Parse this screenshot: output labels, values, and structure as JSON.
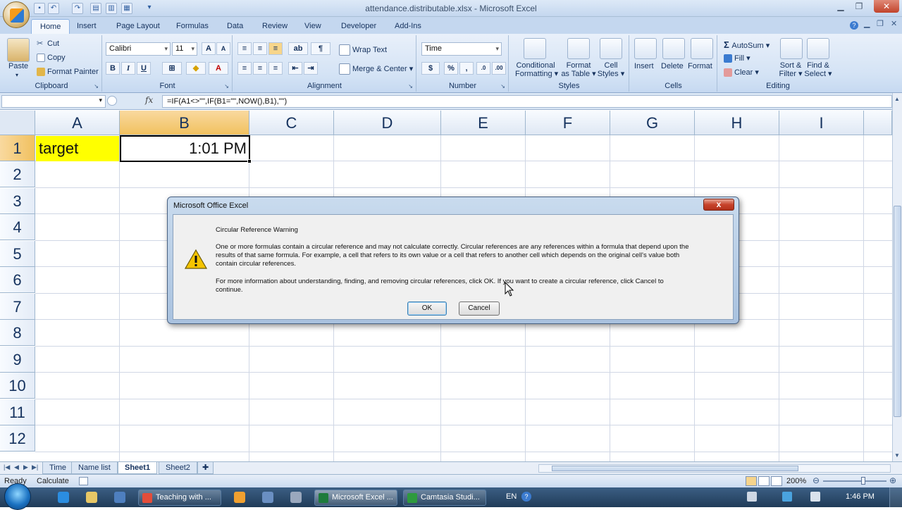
{
  "window": {
    "title": "attendance.distributable.xlsx - Microsoft Excel"
  },
  "ribbon": {
    "tabs": [
      "Home",
      "Insert",
      "Page Layout",
      "Formulas",
      "Data",
      "Review",
      "View",
      "Developer",
      "Add-Ins"
    ],
    "clipboard": {
      "paste": "Paste",
      "cut": "Cut",
      "copy": "Copy",
      "format_painter": "Format Painter",
      "label": "Clipboard"
    },
    "font": {
      "name": "Calibri",
      "size": "11",
      "bold": "B",
      "italic": "I",
      "underline": "U",
      "label": "Font"
    },
    "alignment": {
      "wrap_text": "Wrap Text",
      "merge_center": "Merge & Center",
      "label": "Alignment"
    },
    "number": {
      "format": "Time",
      "currency": "$",
      "percent": "%",
      "comma": ",",
      "label": "Number"
    },
    "styles": {
      "conditional": "Conditional",
      "conditional2": "Formatting",
      "format_as": "Format",
      "format_as2": "as Table",
      "cell": "Cell",
      "cell2": "Styles",
      "label": "Styles"
    },
    "cells": {
      "insert": "Insert",
      "delete": "Delete",
      "format": "Format",
      "label": "Cells"
    },
    "editing": {
      "autosum": "AutoSum",
      "fill": "Fill",
      "clear": "Clear",
      "sort": "Sort &",
      "sort2": "Filter",
      "find": "Find &",
      "find2": "Select",
      "label": "Editing"
    }
  },
  "formula_bar": {
    "fx": "fx",
    "formula": "=IF(A1<>\"\",IF(B1=\"\",NOW(),B1),\"\")"
  },
  "grid": {
    "columns": [
      "A",
      "B",
      "C",
      "D",
      "E",
      "F",
      "G",
      "H",
      "I"
    ],
    "rows": [
      "1",
      "2",
      "3",
      "4",
      "5",
      "6",
      "7",
      "8",
      "9",
      "10",
      "11",
      "12"
    ],
    "cells": {
      "A1": "target",
      "B1": "1:01 PM"
    }
  },
  "sheets": {
    "tabs": [
      "Time",
      "Name list",
      "Sheet1",
      "Sheet2"
    ],
    "active": "Sheet1"
  },
  "status": {
    "ready": "Ready",
    "calculate": "Calculate",
    "zoom": "200%"
  },
  "dialog": {
    "title": "Microsoft Office Excel",
    "close": "x",
    "heading": "Circular Reference Warning",
    "para1_l1": "One or more formulas contain a circular reference and may not calculate correctly. Circular references are any references within a formula that depend upon the",
    "para1_l2": "results of that same formula. For example, a cell that refers to its own value or a cell that refers to another cell which depends on the original cell's value both",
    "para1_l3": "contain circular references.",
    "para2_l1": "For more information about understanding, finding, and removing circular references, click OK. If you want to create a circular reference, click Cancel to",
    "para2_l2": "continue.",
    "ok": "OK",
    "cancel": "Cancel"
  },
  "taskbar": {
    "buttons": [
      "Teaching with ...",
      "Microsoft Excel ...",
      "Camtasia Studi..."
    ],
    "lang": "EN",
    "clock": "1:46 PM"
  },
  "colors": {
    "accent": "#c4d7ef",
    "selected_header": "#f1c15f",
    "highlight_cell": "#ffff00"
  }
}
